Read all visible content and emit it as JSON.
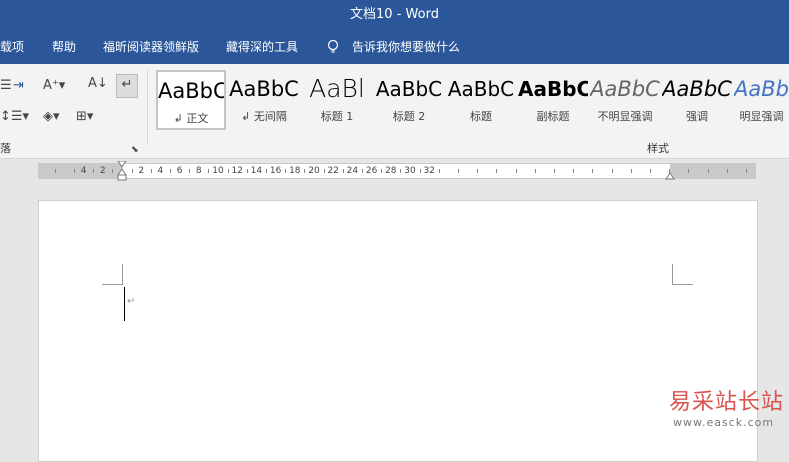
{
  "window": {
    "title": "文档10 - Word"
  },
  "menu": {
    "items": [
      "载项",
      "帮助",
      "福昕阅读器领鲜版",
      "藏得深的工具"
    ],
    "tell_me": "告诉我你想要做什么"
  },
  "ribbon": {
    "paragraph_group_label": "落",
    "styles_group_label": "样式",
    "styles": [
      {
        "preview": "AaBbC",
        "name": "正文",
        "selected": true
      },
      {
        "preview": "AaBbC",
        "name": "无间隔"
      },
      {
        "preview": "AaBl",
        "name": "标题 1"
      },
      {
        "preview": "AaBbC",
        "name": "标题 2"
      },
      {
        "preview": "AaBbC",
        "name": "标题"
      },
      {
        "preview": "AaBbC",
        "name": "副标题"
      },
      {
        "preview": "AaBbC",
        "name": "不明显强调"
      },
      {
        "preview": "AaBbC",
        "name": "强调"
      },
      {
        "preview": "AaBbC",
        "name": "明显强调"
      }
    ]
  },
  "ruler": {
    "numbers": [
      "4",
      "2",
      "2",
      "4",
      "6",
      "8",
      "10",
      "12",
      "14",
      "16",
      "18",
      "20",
      "22",
      "24",
      "26",
      "28",
      "30",
      "32"
    ]
  },
  "watermark": {
    "brand": "易采站长站",
    "url": "www.easck.com"
  },
  "colors": {
    "accent": "#2b579a"
  }
}
